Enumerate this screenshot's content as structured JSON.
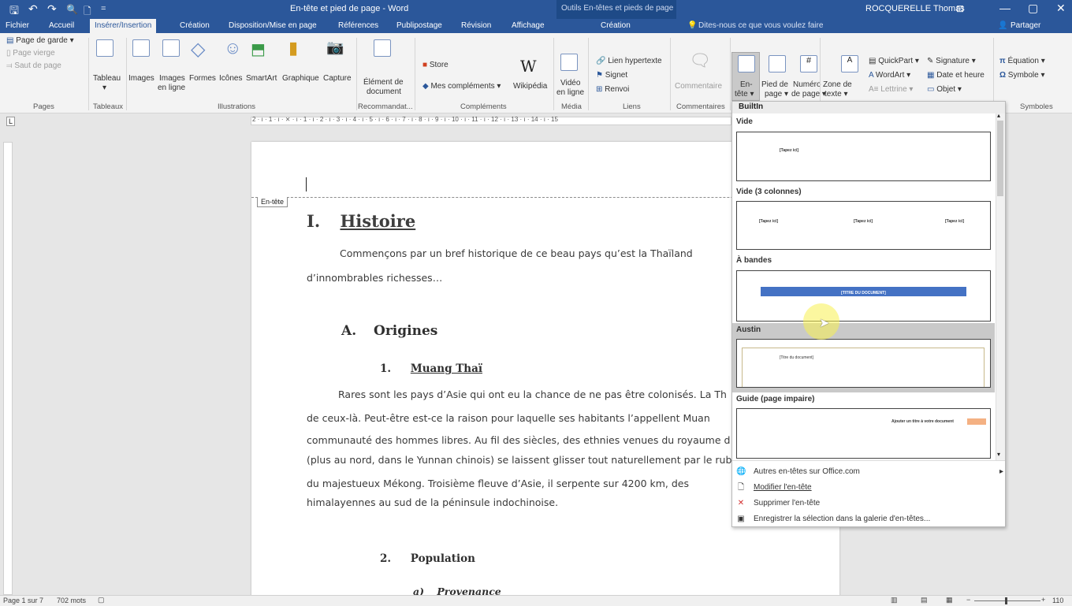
{
  "window": {
    "title": "En-tête et pied de page - Word",
    "context_title": "Outils En-têtes et pieds de page",
    "user": "ROCQUERELLE Thomas",
    "qat": {
      "save": "🖫",
      "undo": "↶",
      "redo": "↷",
      "preview": "🔍",
      "new": "🗋",
      "more": "="
    },
    "controls": {
      "ribbon_opts": "⊡",
      "minimize": "—",
      "restore": "▢",
      "close": "✕"
    }
  },
  "menu": {
    "tabs": [
      "Fichier",
      "Accueil",
      "Insérer/Insertion",
      "Création",
      "Disposition/Mise en page",
      "Références",
      "Publipostage",
      "Révision",
      "Affichage"
    ],
    "context_tab": "Création",
    "search_placeholder": "Dites-nous ce que vous voulez faire",
    "share": "Partager"
  },
  "ribbon": {
    "pages": {
      "cover": "Page de garde ▾",
      "blank": "Page vierge",
      "break": "Saut de page",
      "label": "Pages"
    },
    "tables": {
      "table": "Tableau",
      "arrow": "▾",
      "label": "Tableaux"
    },
    "illustrations": {
      "images": "Images",
      "online_images_1": "Images",
      "online_images_2": "en ligne",
      "shapes": "Formes",
      "icons": "Icônes",
      "smartart": "SmartArt",
      "chart": "Graphique",
      "capture": "Capture",
      "label": "Illustrations"
    },
    "recommended": {
      "element_1": "Élément de",
      "element_2": "document",
      "label": "Recommandat..."
    },
    "addins": {
      "store": "Store",
      "my_addins": "Mes compléments",
      "wikipedia": "Wikipédia",
      "wiki_glyph": "W",
      "label": "Compléments"
    },
    "media": {
      "video_1": "Vidéo",
      "video_2": "en ligne",
      "label": "Média"
    },
    "links": {
      "hyperlink": "Lien hypertexte",
      "bookmark": "Signet",
      "crossref": "Renvoi",
      "label": "Liens"
    },
    "comments": {
      "comment": "Commentaire",
      "label": "Commentaires"
    },
    "headerfooter": {
      "header_1": "En-",
      "header_2": "tête ▾",
      "footer_1": "Pied de",
      "footer_2": "page ▾",
      "pagenum_1": "Numéro",
      "pagenum_2": "de page ▾"
    },
    "text": {
      "textbox_1": "Zone de",
      "textbox_2": "texte ▾",
      "quickpart": "QuickPart ▾",
      "wordart": "WordArt ▾",
      "dropcap": "Lettrine ▾",
      "signature": "Signature ▾",
      "datetime": "Date et heure",
      "object": "Objet ▾"
    },
    "symbols": {
      "equation": "Équation ▾",
      "symbol": "Symbole ▾",
      "label": "Symboles"
    }
  },
  "ruler": {
    "marks": "2 · ı · 1 · ı · ⨯ · ı · 1 · ı · 2 · ı · 3 · ı · 4 · ı · 5 · ı · 6 · ı · 7 · ı · 8 · ı · 9 · ı · 10 · ı · 11 · ı · 12 · ı · 13 · ı · 14 · ı · 15"
  },
  "document": {
    "header_label": "En-tête",
    "h1_num": "I.",
    "h1_text": "Histoire",
    "p1_l1": "Commençons par un bref historique de ce beau pays qu’est la Thaïland",
    "p1_l2": "d’innombrables richesses…",
    "h2_num": "A.",
    "h2_text": "Origines",
    "h3_num": "1.",
    "h3_text": "Muang Thaï",
    "p2_l1": "Rares sont les pays d’Asie qui ont eu la chance de ne pas être colonisés. La Th",
    "p2_l2": "de ceux-là. Peut-être est-ce la raison pour laquelle ses habitants l’appellent Muan",
    "p2_l3": "communauté des hommes libres. Au fil des siècles, des ethnies venues du royaume d",
    "p2_l4": "(plus au nord, dans le Yunnan chinois) se laissent glisser tout naturellement par le ruban",
    "p2_l5": "du majestueux Mékong. Troisième fleuve d’Asie, il serpente sur 4200 km, des",
    "p2_l6": "himalayennes au sud de la péninsule indochinoise.",
    "h4_num": "2.",
    "h4_text": "Population",
    "h5_num": "a)",
    "h5_text": "Provenance"
  },
  "gallery": {
    "builtin": "BuiltIn",
    "sections": [
      {
        "name": "Vide",
        "labels": [
          "[Tapez ici]"
        ]
      },
      {
        "name": "Vide (3 colonnes)",
        "labels": [
          "[Tapez ici]",
          "[Tapez ici]",
          "[Tapez ici]"
        ]
      },
      {
        "name": "À bandes",
        "labels": [
          "[TITRE DU DOCUMENT]"
        ]
      },
      {
        "name": "Austin",
        "labels": [
          "[Titre du document]"
        ]
      },
      {
        "name": "Guide (page impaire)",
        "labels": [
          "Ajouter un titre à votre document"
        ]
      }
    ],
    "menu": [
      {
        "label": "Autres en-têtes sur Office.com",
        "icon": "globe-icon",
        "enabled": true
      },
      {
        "label": "Modifier l'en-tête",
        "icon": "page-edit-icon",
        "enabled": true
      },
      {
        "label": "Supprimer l'en-tête",
        "icon": "delete-icon",
        "enabled": true
      },
      {
        "label": "Enregistrer la sélection dans la galerie d'en-têtes...",
        "icon": "save-selection-icon",
        "enabled": false
      }
    ],
    "submenu_arrow": "▸"
  },
  "statusbar": {
    "page": "Page 1 sur 7",
    "words": "702 mots",
    "zoom": "110"
  },
  "colors": {
    "brand": "#2b579a",
    "ribbon": "#f3f3f3",
    "accent_band": "#4472c4",
    "guide_orange": "#f4b183"
  }
}
